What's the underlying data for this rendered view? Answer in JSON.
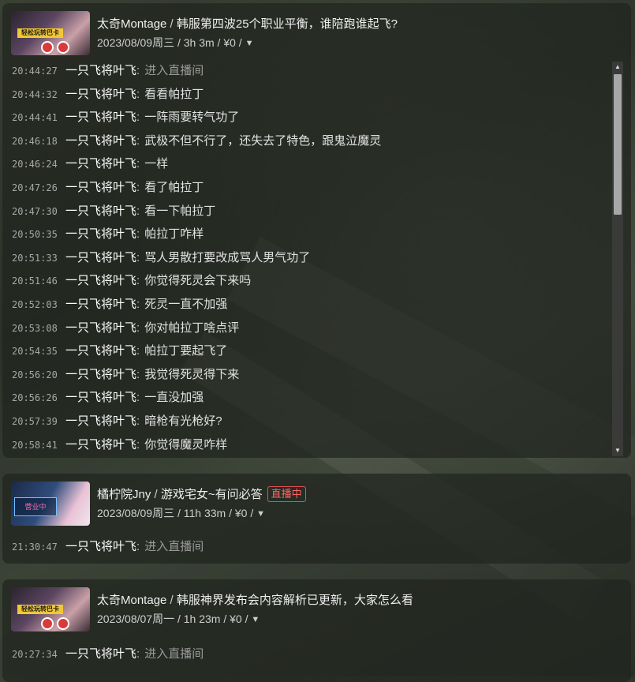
{
  "sessions": [
    {
      "streamer": "太奇Montage",
      "separator": " / ",
      "title": "韩服第四波25个职业平衡，谁陪跑谁起飞?",
      "date": "2023/08/09周三",
      "duration": "3h 3m",
      "income": "¥0",
      "thumbnail_text": "轻松玩转巴卡",
      "messages": [
        {
          "time": "20:44:27",
          "user": "一只飞将叶飞",
          "text": "进入直播间",
          "system": true
        },
        {
          "time": "20:44:32",
          "user": "一只飞将叶飞",
          "text": "看看帕拉丁"
        },
        {
          "time": "20:44:41",
          "user": "一只飞将叶飞",
          "text": "一阵雨要转气功了"
        },
        {
          "time": "20:46:18",
          "user": "一只飞将叶飞",
          "text": "武极不但不行了，还失去了特色，跟鬼泣魔灵"
        },
        {
          "time": "20:46:24",
          "user": "一只飞将叶飞",
          "text": "一样"
        },
        {
          "time": "20:47:26",
          "user": "一只飞将叶飞",
          "text": "看了帕拉丁"
        },
        {
          "time": "20:47:30",
          "user": "一只飞将叶飞",
          "text": "看一下帕拉丁"
        },
        {
          "time": "20:50:35",
          "user": "一只飞将叶飞",
          "text": "帕拉丁咋样"
        },
        {
          "time": "20:51:33",
          "user": "一只飞将叶飞",
          "text": "骂人男散打要改成骂人男气功了"
        },
        {
          "time": "20:51:46",
          "user": "一只飞将叶飞",
          "text": "你觉得死灵会下来吗"
        },
        {
          "time": "20:52:03",
          "user": "一只飞将叶飞",
          "text": "死灵一直不加强"
        },
        {
          "time": "20:53:08",
          "user": "一只飞将叶飞",
          "text": "你对帕拉丁啥点评"
        },
        {
          "time": "20:54:35",
          "user": "一只飞将叶飞",
          "text": "帕拉丁要起飞了"
        },
        {
          "time": "20:56:20",
          "user": "一只飞将叶飞",
          "text": "我觉得死灵得下来"
        },
        {
          "time": "20:56:26",
          "user": "一只飞将叶飞",
          "text": "一直没加强"
        },
        {
          "time": "20:57:39",
          "user": "一只飞将叶飞",
          "text": "暗枪有光枪好?"
        },
        {
          "time": "20:58:41",
          "user": "一只飞将叶飞",
          "text": "你觉得魔灵咋样"
        }
      ]
    },
    {
      "streamer": "橘柠院Jny",
      "separator": " / ",
      "title": "游戏宅女~有问必答",
      "live_badge": "直播中",
      "date": "2023/08/09周三",
      "duration": "11h 33m",
      "income": "¥0",
      "thumbnail_text": "营业中",
      "messages": [
        {
          "time": "21:30:47",
          "user": "一只飞将叶飞",
          "text": "进入直播间",
          "system": true
        }
      ]
    },
    {
      "streamer": "太奇Montage",
      "separator": " / ",
      "title": "韩服神界发布会内容解析已更新，大家怎么看",
      "date": "2023/08/07周一",
      "duration": "1h 23m",
      "income": "¥0",
      "thumbnail_text": "轻松玩转巴卡",
      "messages": [
        {
          "time": "20:27:34",
          "user": "一只飞将叶飞",
          "text": "进入直播间",
          "system": true
        }
      ]
    }
  ],
  "ui": {
    "meta_sep": " / ",
    "expand_arrow": "▼",
    "colon": ":",
    "scroll_up": "▲",
    "scroll_down": "▼"
  },
  "colors": {
    "live_badge": "#ff6464",
    "system_text": "#9a9a9a"
  }
}
